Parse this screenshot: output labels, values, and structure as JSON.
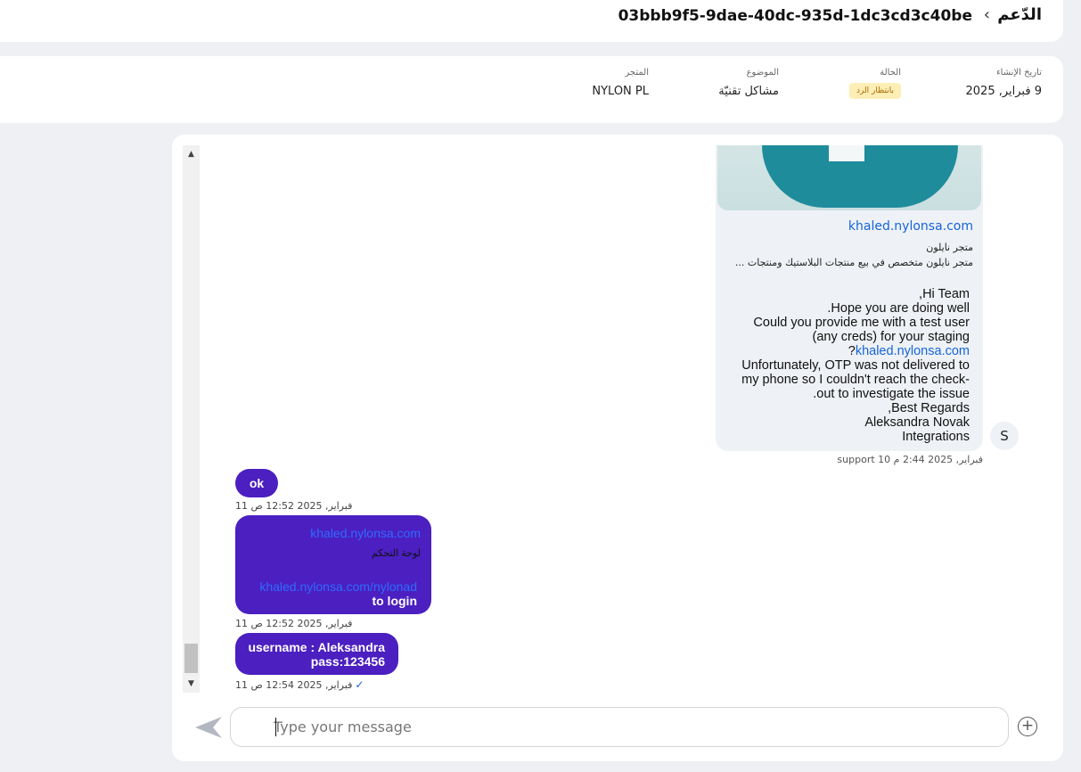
{
  "header": {
    "ticket_id": "03bbb9f5-9dae-40dc-935d-1dc3cd3c40be",
    "breadcrumb_chevron": "‹",
    "section": "الدّعم"
  },
  "info": {
    "created_label": "تاريخ الإنشاء",
    "created_value": "9 فبراير, 2025",
    "status_label": "الحالة",
    "status_value": "بانتظار الرد",
    "subject_label": "الموضوع",
    "subject_value": "مشاكل تقنيّة",
    "store_label": "المتجر",
    "store_value": "NYLON PL"
  },
  "scrollbar": {
    "up": "▲",
    "down": "▼"
  },
  "incoming": {
    "preview_url": "khaled.nylonsa.com",
    "preview_title": "متجر نايلون",
    "preview_desc": "متجر نايلون متخصص في بيع منتجات البلاستيك ومنتجات ...",
    "lines": [
      ",Hi Team",
      ".Hope you are doing well",
      "Could you provide me with a test user",
      "(any creds) for your staging",
      "?",
      "Unfortunately, OTP was not delivered to",
      "my phone so I couldn't reach the check-",
      ".out to investigate the issue",
      ",Best Regards",
      "Aleksandra Novak",
      "Integrations"
    ],
    "inline_link": "khaled.nylonsa.com",
    "avatar": "S",
    "meta": "support 10 فبراير, 2025 2:44 م"
  },
  "outgoing": [
    {
      "text": "ok",
      "meta": "11 فبراير, 2025 12:52 ص"
    },
    {
      "preview_url": "khaled.nylonsa.com",
      "preview_title": "لوحة التحكم",
      "link": "khaled.nylonsa.com/nylonad",
      "line2": "to login",
      "meta": "11 فبراير, 2025 12:52 ص"
    },
    {
      "line1": "username : Aleksandra",
      "line2": "pass:123456",
      "meta": "11 فبراير, 2025 12:54 ص",
      "check": "✓"
    }
  ],
  "composer": {
    "placeholder": "Type your message",
    "add_symbol": "+"
  }
}
